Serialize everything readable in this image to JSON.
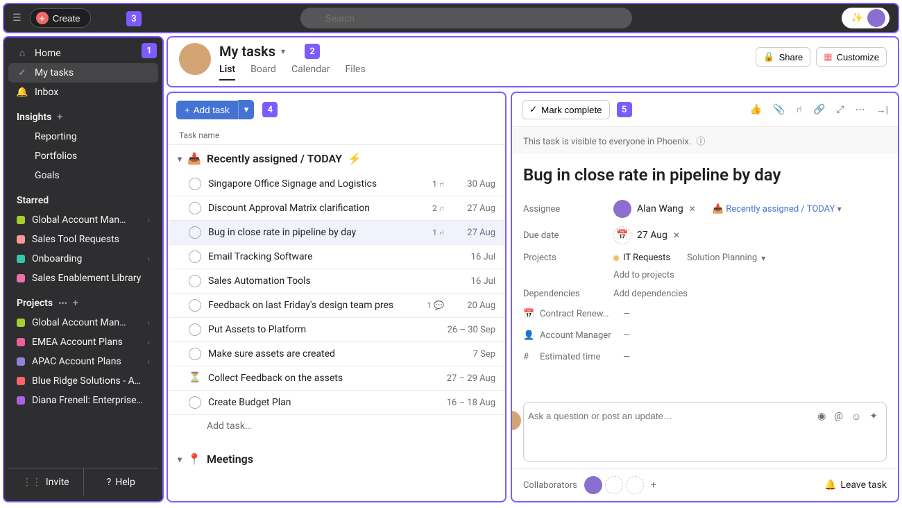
{
  "topbar": {
    "create_label": "Create",
    "search_placeholder": "Search"
  },
  "sidebar": {
    "nav": [
      {
        "label": "Home",
        "icon": "⌂"
      },
      {
        "label": "My tasks",
        "icon": "✓",
        "active": true
      },
      {
        "label": "Inbox",
        "icon": "🔔"
      }
    ],
    "insights_header": "Insights",
    "insights": [
      {
        "label": "Reporting"
      },
      {
        "label": "Portfolios"
      },
      {
        "label": "Goals"
      }
    ],
    "starred_header": "Starred",
    "starred": [
      {
        "label": "Global Account Man…",
        "color": "#a4cf30"
      },
      {
        "label": "Sales Tool Requests",
        "color": "#fc979a"
      },
      {
        "label": "Onboarding",
        "color": "#37c5ab"
      },
      {
        "label": "Sales Enablement Library",
        "color": "#f06eaa"
      }
    ],
    "projects_header": "Projects",
    "projects": [
      {
        "label": "Global Account Man…",
        "color": "#a4cf30"
      },
      {
        "label": "EMEA Account Plans",
        "color": "#e8619c"
      },
      {
        "label": "APAC Account Plans",
        "color": "#8e84e0"
      },
      {
        "label": "Blue Ridge Solutions - A…",
        "color": "#fc636b"
      },
      {
        "label": "Diana Frenell: Enterprise…",
        "color": "#aa62e3"
      }
    ],
    "invite_label": "Invite",
    "help_label": "Help"
  },
  "header": {
    "title": "My tasks",
    "tabs": [
      "List",
      "Board",
      "Calendar",
      "Files"
    ],
    "share_label": "Share",
    "customize_label": "Customize"
  },
  "list": {
    "add_task_label": "Add task",
    "col_name": "Task name",
    "section1_title": "Recently assigned / TODAY",
    "tasks": [
      {
        "name": "Singapore Office Signage and Logistics",
        "subtasks": "1",
        "date": "30 Aug"
      },
      {
        "name": "Discount Approval Matrix clarification",
        "subtasks": "2",
        "date": "27 Aug"
      },
      {
        "name": "Bug in close rate in pipeline by day",
        "subtasks": "1",
        "date": "27 Aug",
        "selected": true
      },
      {
        "name": "Email Tracking Software",
        "date": "16 Jul"
      },
      {
        "name": "Sales Automation Tools",
        "date": "16 Jul"
      },
      {
        "name": "Feedback on last Friday's design team pres",
        "comments": "1",
        "date": "20 Aug"
      },
      {
        "name": "Put Assets to Platform",
        "date": "26 – 30 Sep"
      },
      {
        "name": "Make sure assets are created",
        "date": "7 Sep"
      },
      {
        "name": "Collect Feedback on the assets",
        "date": "27 – 29 Aug",
        "hourglass": true
      },
      {
        "name": "Create Budget Plan",
        "date": "16 – 18 Aug"
      }
    ],
    "add_task_placeholder": "Add task…",
    "section2_title": "Meetings"
  },
  "detail": {
    "mark_complete": "Mark complete",
    "visibility_text": "This task is visible to everyone in Phoenix.",
    "title": "Bug in close rate in pipeline by day",
    "fields": {
      "assignee_label": "Assignee",
      "assignee_name": "Alan Wang",
      "assignee_section": "Recently assigned / TODAY",
      "due_date_label": "Due date",
      "due_date_value": "27 Aug",
      "projects_label": "Projects",
      "project1": "IT Requests",
      "project2": "Solution Planning",
      "add_to_projects": "Add to projects",
      "dependencies_label": "Dependencies",
      "add_dependencies": "Add dependencies"
    },
    "custom_fields": [
      {
        "icon": "📅",
        "label": "Contract Renew…",
        "value": "—"
      },
      {
        "icon": "👤",
        "label": "Account Manager",
        "value": "—"
      },
      {
        "icon": "#",
        "label": "Estimated time",
        "value": "—"
      }
    ],
    "comment_placeholder": "Ask a question or post an update…",
    "collaborators_label": "Collaborators",
    "leave_task_label": "Leave task"
  },
  "badges": {
    "b1": "1",
    "b2": "2",
    "b3": "3",
    "b4": "4",
    "b5": "5"
  }
}
